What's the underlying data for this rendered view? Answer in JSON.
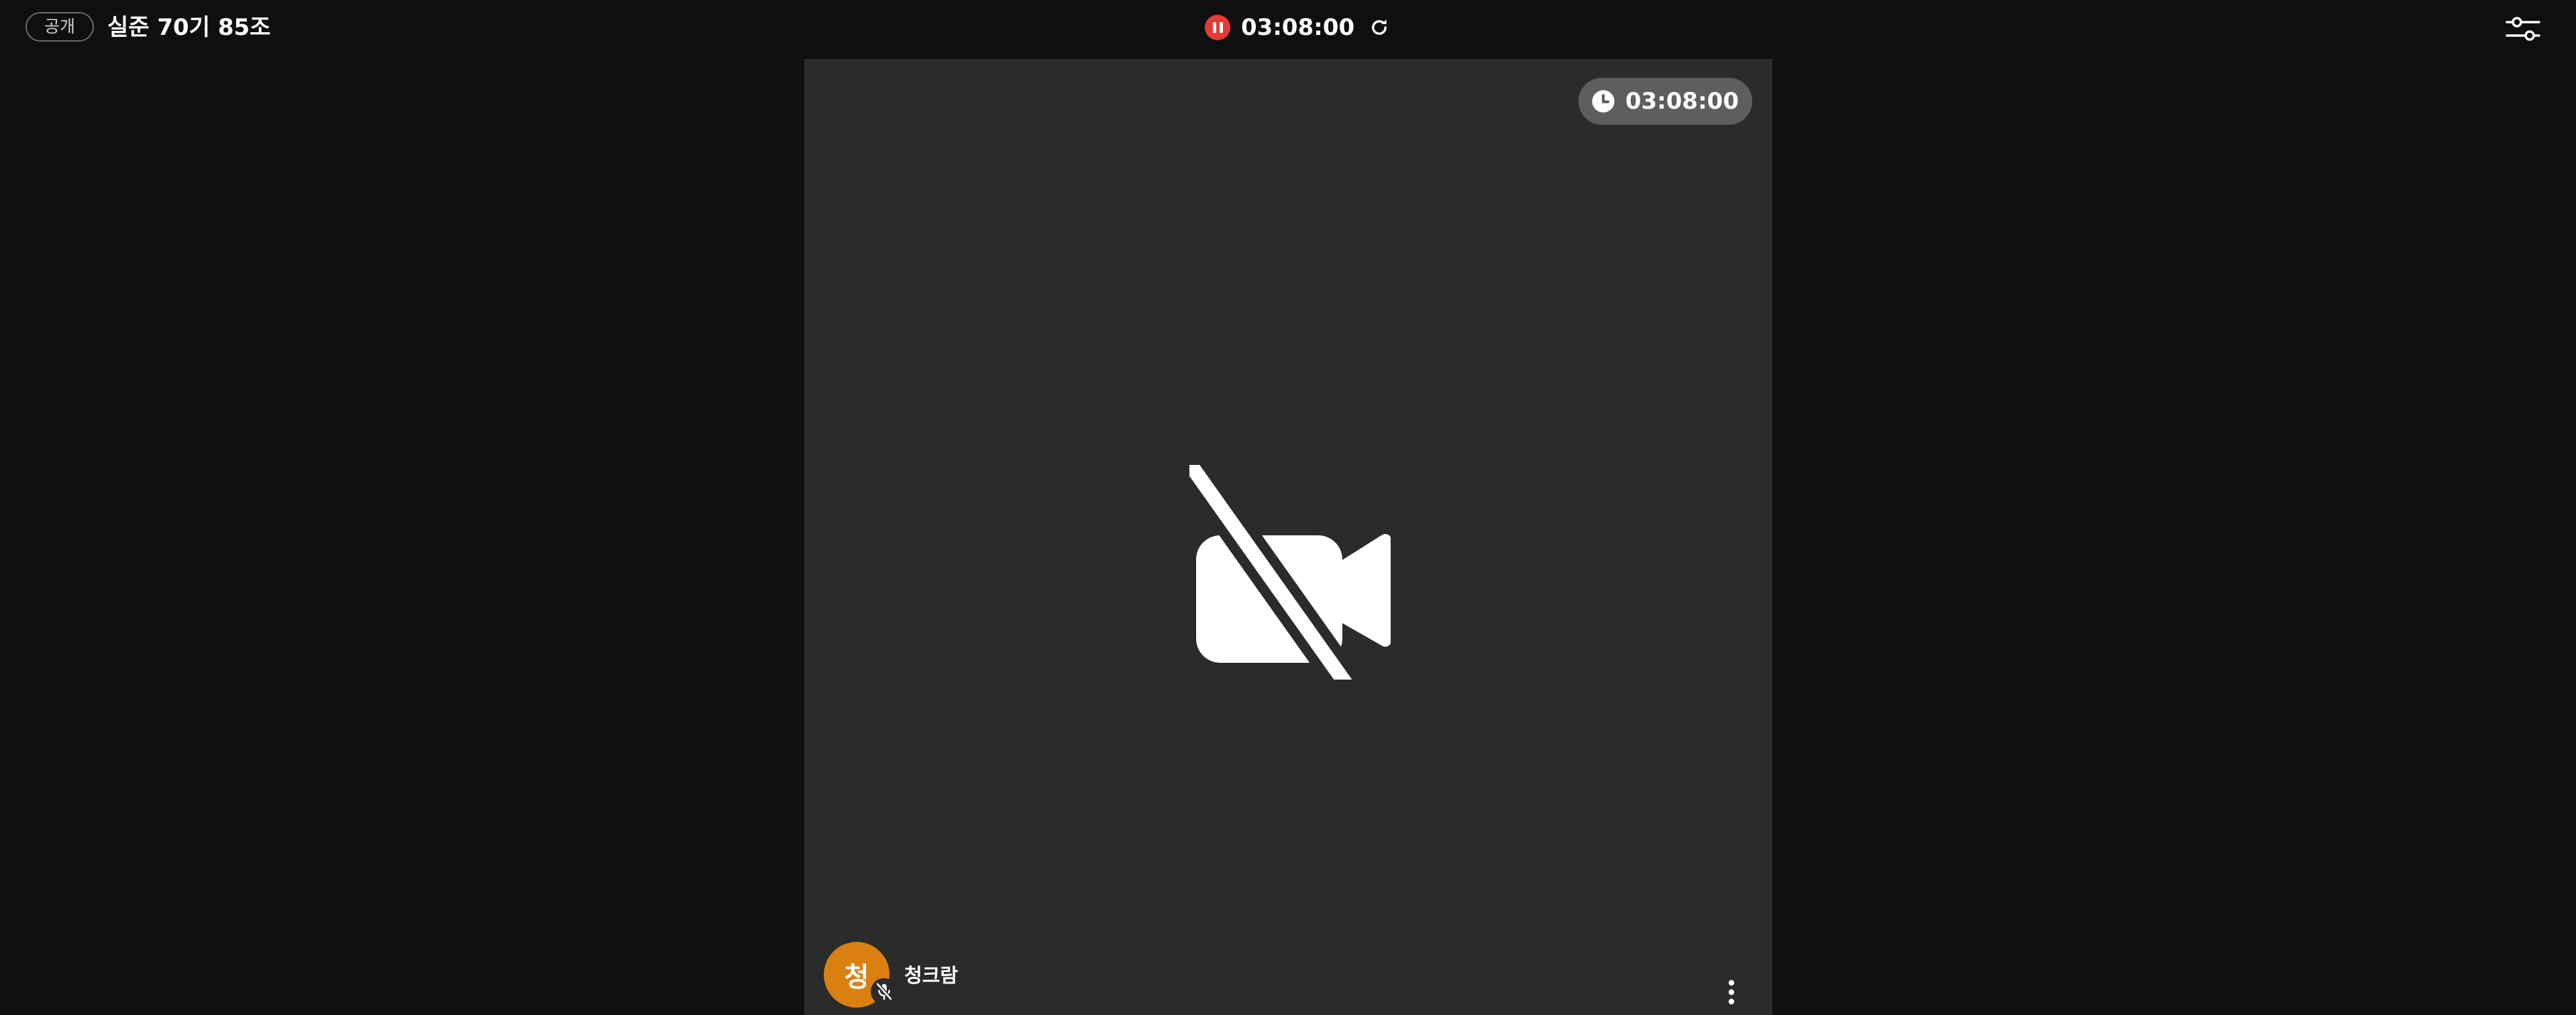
{
  "header": {
    "visibility_badge": "공개",
    "room_title": "실준 70기 85조",
    "recording_time": "03:08:00",
    "icons": {
      "pause": "pause-icon",
      "refresh": "refresh-icon",
      "settings": "sliders-icon"
    },
    "colors": {
      "record_red": "#e53935"
    }
  },
  "tile": {
    "timer": "03:08:00",
    "video_state_icon": "video-off-icon",
    "participant": {
      "avatar_initial": "청",
      "name": "청크람",
      "mic_icon": "mic-off-icon",
      "avatar_color": "#d98011"
    },
    "more_icon": "more-vertical-icon"
  }
}
